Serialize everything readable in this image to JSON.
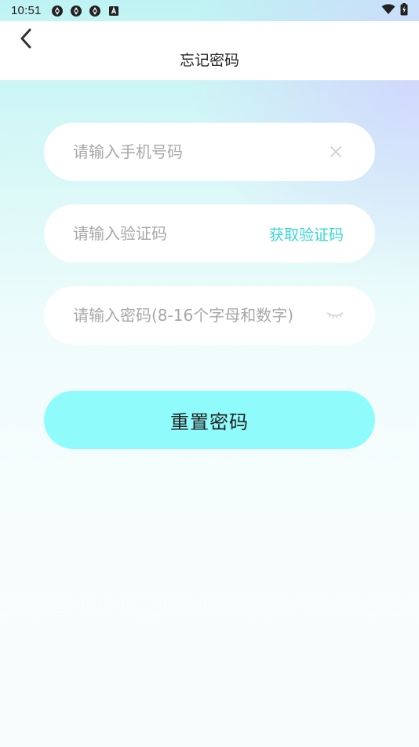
{
  "status_bar": {
    "time": "10:51",
    "left_icons": [
      "aperture-icon",
      "aperture-icon",
      "aperture-icon",
      "a-badge-icon"
    ],
    "right_icons": [
      "wifi-icon",
      "battery-charging-icon"
    ]
  },
  "nav": {
    "back_icon": "chevron-left-icon",
    "title": "忘记密码"
  },
  "form": {
    "phone": {
      "value": "",
      "placeholder": "请输入手机号码",
      "clear_icon": "close-icon"
    },
    "code": {
      "value": "",
      "placeholder": "请输入验证码",
      "get_code_label": "获取验证码"
    },
    "password": {
      "value": "",
      "placeholder": "请输入密码(8-16个字母和数字)",
      "toggle_icon": "eye-closed-icon"
    },
    "submit_label": "重置密码"
  },
  "colors": {
    "accent": "#3ad6d6",
    "button": "#90fbfb",
    "placeholder": "#a8a8a8",
    "background_top": "#bff3f3",
    "background_bottom": "#f8fcfc"
  }
}
